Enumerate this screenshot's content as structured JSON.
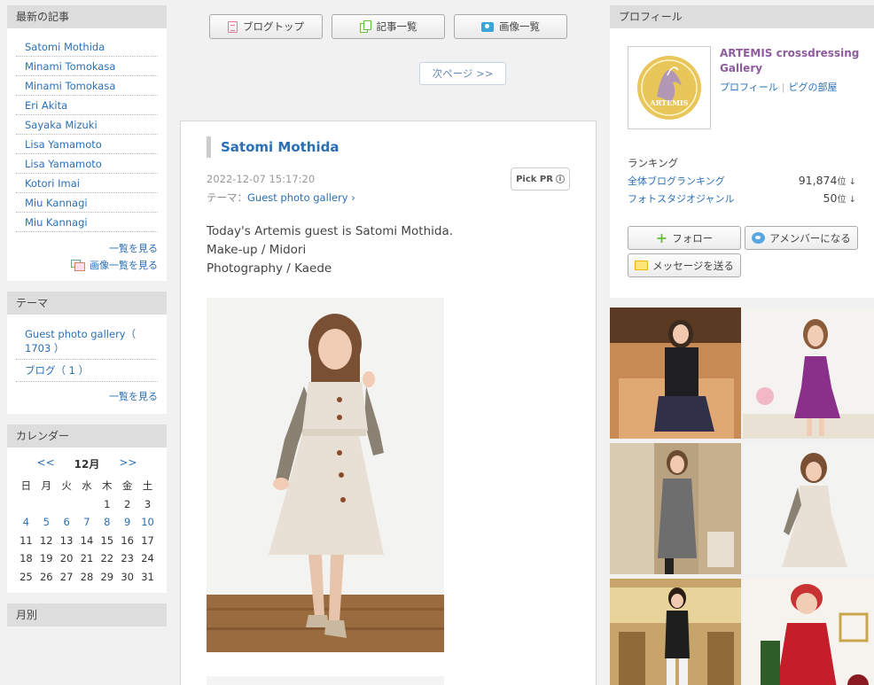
{
  "sidebar": {
    "recent": {
      "title": "最新の記事",
      "items": [
        "Satomi Mothida",
        "Minami Tomokasa",
        "Minami Tomokasa",
        "Eri Akita",
        "Sayaka Mizuki",
        "Lisa Yamamoto",
        "Lisa Yamamoto",
        "Kotori Imai",
        "Miu Kannagi",
        "Miu Kannagi"
      ],
      "more": "一覧を見る",
      "more_images": "画像一覧を見る"
    },
    "theme": {
      "title": "テーマ",
      "items": [
        "Guest photo gallery（ 1703 ）",
        "ブログ（ 1 ）"
      ],
      "more": "一覧を見る"
    },
    "calendar": {
      "title": "カレンダー",
      "prev": "<<",
      "next": ">>",
      "month": "12月",
      "weekdays": [
        "日",
        "月",
        "火",
        "水",
        "木",
        "金",
        "土"
      ],
      "rows": [
        [
          "",
          "",
          "",
          "",
          "1",
          "2",
          "3"
        ],
        [
          "4",
          "5",
          "6",
          "7",
          "8",
          "9",
          "10"
        ],
        [
          "11",
          "12",
          "13",
          "14",
          "15",
          "16",
          "17"
        ],
        [
          "18",
          "19",
          "20",
          "21",
          "22",
          "23",
          "24"
        ],
        [
          "25",
          "26",
          "27",
          "28",
          "29",
          "30",
          "31"
        ]
      ],
      "linked_days": [
        "4",
        "5",
        "6",
        "7",
        "8",
        "9",
        "10"
      ]
    },
    "monthly": {
      "title": "月別"
    }
  },
  "toolbar": {
    "blog_top": "ブログトップ",
    "article_list": "記事一覧",
    "image_list": "画像一覧",
    "next_page": "次ページ >>"
  },
  "article": {
    "title": "Satomi Mothida",
    "datetime": "2022-12-07 15:17:20",
    "theme_label": "テーマ：",
    "theme_link": "Guest photo gallery",
    "pick_pr": "Pick PR",
    "body_lines": [
      "Today's Artemis guest is Satomi Mothida.",
      "Make-up / Midori",
      "Photography / Kaede"
    ]
  },
  "profile": {
    "title": "プロフィール",
    "name": "ARTEMIS crossdressing Gallery",
    "link_profile": "プロフィール",
    "link_room": "ピグの部屋",
    "ranking_label": "ランキング",
    "ranking": [
      {
        "label": "全体ブログランキング",
        "value": "91,874",
        "unit": "位 ↓"
      },
      {
        "label": "フォトスタジオジャンル",
        "value": "50",
        "unit": "位 ↓"
      }
    ],
    "follow": "フォロー",
    "amember": "アメンバーになる",
    "message": "メッセージを送る",
    "logo_text": "ARTEMIS"
  },
  "colors": {
    "link": "#2a6fb6",
    "profile_name": "#8e5b9e",
    "header_bg": "#dddddd",
    "page_bg": "#f1f1f1"
  }
}
